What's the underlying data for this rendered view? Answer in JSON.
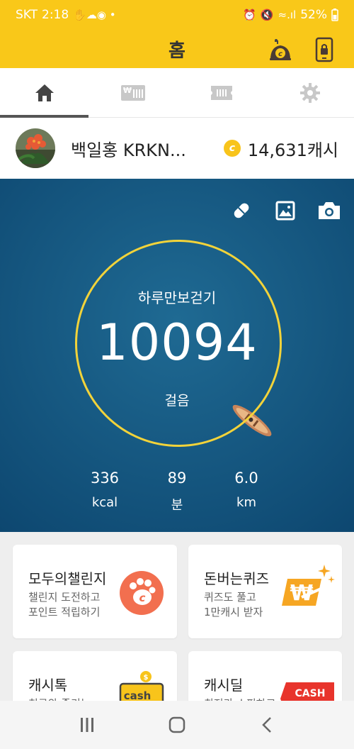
{
  "status_bar": {
    "carrier": "SKT",
    "time": "2:18",
    "battery": "52%"
  },
  "app_bar": {
    "title": "홈",
    "actions": [
      "cash-bag-icon",
      "phone-lock-icon"
    ]
  },
  "tabs": [
    {
      "icon": "home-icon",
      "active": true
    },
    {
      "icon": "ticket-icon",
      "active": false
    },
    {
      "icon": "coupon-icon",
      "active": false
    },
    {
      "icon": "gear-icon",
      "active": false
    }
  ],
  "profile": {
    "name": "백일홍 KRKN...",
    "cash": "14,631캐시",
    "coin_symbol": "c"
  },
  "pedometer": {
    "title": "하루만보걷기",
    "steps": "10094",
    "steps_unit": "걸음",
    "tools": [
      "pill-icon",
      "image-icon",
      "camera-icon"
    ],
    "stats": [
      {
        "value": "336",
        "unit": "kcal"
      },
      {
        "value": "89",
        "unit": "분"
      },
      {
        "value": "6.0",
        "unit": "km"
      }
    ]
  },
  "cards": [
    {
      "title": "모두의챌린지",
      "desc": [
        "챌린지 도전하고",
        "포인트 적립하기"
      ],
      "icon": "paw-coin-icon"
    },
    {
      "title": "돈버는퀴즈",
      "desc": [
        "퀴즈도 풀고",
        "1만캐시 받자"
      ],
      "icon": "won-sparkle-icon"
    },
    {
      "title": "캐시톡",
      "desc": [
        "친구와 즐기는"
      ],
      "icon": "cash-chat-icon",
      "badge": "cash"
    },
    {
      "title": "캐시딜",
      "desc": [
        "최저가 쇼핑하고"
      ],
      "icon": "cash-deal-icon",
      "badge": "CASH DEAL"
    }
  ],
  "nav": [
    "recent-apps-icon",
    "home-circle-icon",
    "back-icon"
  ],
  "colors": {
    "brand_yellow": "#f9c819",
    "ocean_blue": "#175a83",
    "ring_yellow": "#f2d33a",
    "challenge_orange": "#f26f4f",
    "quiz_orange": "#f6a623",
    "deal_red": "#e8342c"
  }
}
